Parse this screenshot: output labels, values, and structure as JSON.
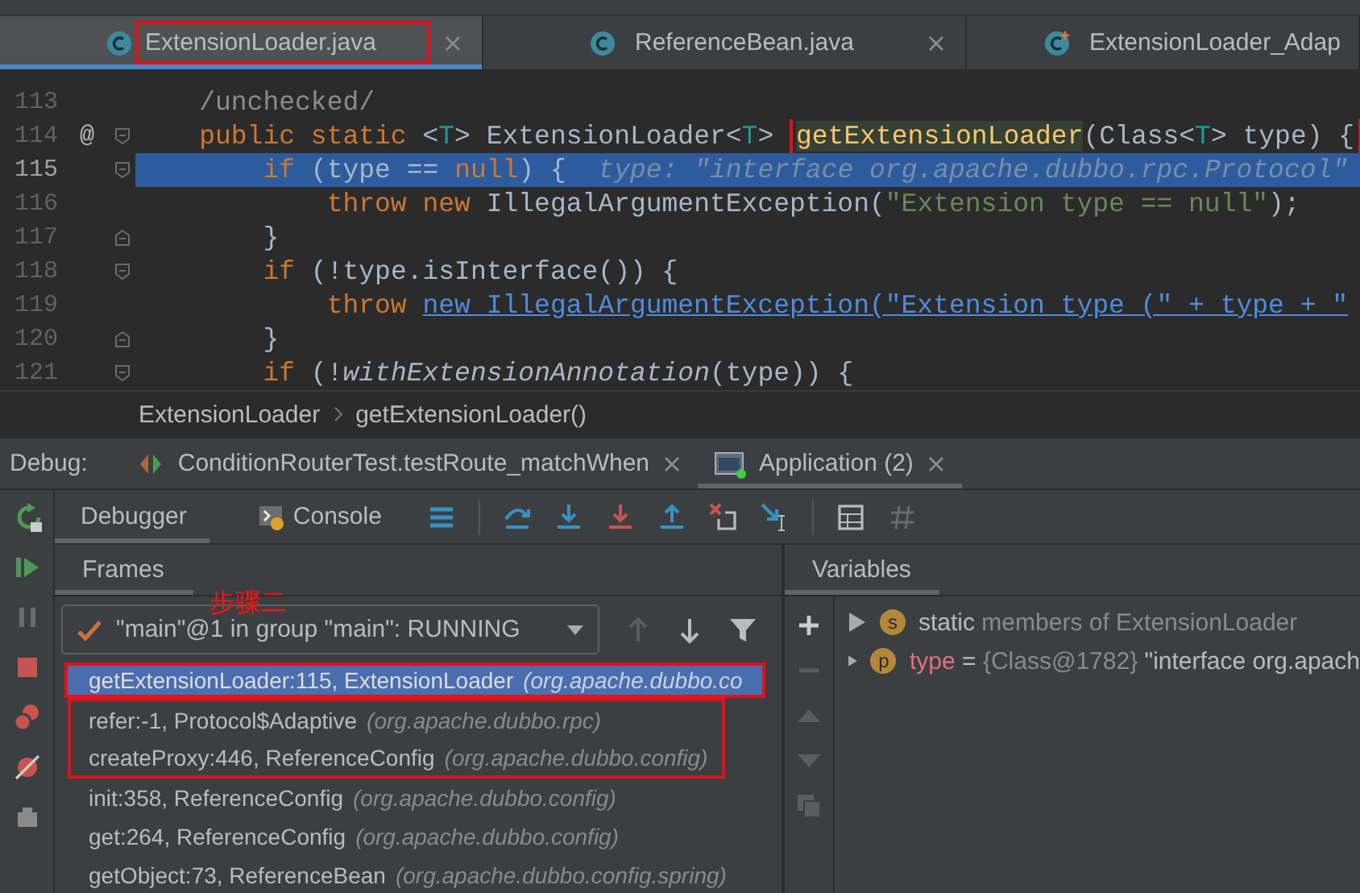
{
  "editor_tabs": [
    {
      "label": "ExtensionLoader.java",
      "selected": true,
      "outlined": true,
      "kind": "class"
    },
    {
      "label": "ReferenceBean.java",
      "selected": false,
      "outlined": false,
      "kind": "class"
    },
    {
      "label": "ExtensionLoader_Adap",
      "selected": false,
      "outlined": false,
      "kind": "generated"
    }
  ],
  "code_lines": [
    {
      "number": "113",
      "current": false,
      "tokens": [
        {
          "kind": "folded",
          "text": "    /unchecked/"
        }
      ]
    },
    {
      "number": "114",
      "current": false,
      "marker": "@",
      "fold_start": true,
      "fold_end": false,
      "tokens": [
        {
          "kind": "keyword",
          "text": "    public static "
        },
        {
          "kind": "plain",
          "text": "<"
        },
        {
          "kind": "typeparam",
          "text": "T"
        },
        {
          "kind": "plain",
          "text": "> ExtensionLoader<"
        },
        {
          "kind": "typeparam",
          "text": "T"
        },
        {
          "kind": "plain",
          "text": "> "
        },
        {
          "kind": "method-decl",
          "text": "getExtensionLoader",
          "outlined": true
        },
        {
          "kind": "plain",
          "text": "(Class<",
          "outlined": true
        },
        {
          "kind": "typeparam",
          "text": "T",
          "outlined": true
        },
        {
          "kind": "plain",
          "text": "> type) {",
          "outlined": true
        }
      ]
    },
    {
      "number": "115",
      "current": true,
      "fold_start": true,
      "fold_end": false,
      "tokens": [
        {
          "kind": "keyword",
          "text": "        if"
        },
        {
          "kind": "plain",
          "text": " (type == "
        },
        {
          "kind": "keyword",
          "text": "null"
        },
        {
          "kind": "plain",
          "text": ") {  "
        },
        {
          "kind": "inline-value",
          "text": "type: \"interface org.apache.dubbo.rpc.Protocol\""
        }
      ]
    },
    {
      "number": "116",
      "current": false,
      "tokens": [
        {
          "kind": "keyword",
          "text": "            throw new "
        },
        {
          "kind": "plain",
          "text": "IllegalArgumentException("
        },
        {
          "kind": "string",
          "text": "\"Extension type == null\""
        },
        {
          "kind": "plain",
          "text": ");"
        }
      ]
    },
    {
      "number": "117",
      "current": false,
      "fold_start": false,
      "fold_end": true,
      "tokens": [
        {
          "kind": "plain",
          "text": "        }"
        }
      ]
    },
    {
      "number": "118",
      "current": false,
      "fold_start": true,
      "fold_end": false,
      "tokens": [
        {
          "kind": "keyword",
          "text": "        if"
        },
        {
          "kind": "plain",
          "text": " (!type.isInterface()) {"
        }
      ]
    },
    {
      "number": "119",
      "current": false,
      "tokens": [
        {
          "kind": "keyword",
          "text": "            throw "
        },
        {
          "kind": "link",
          "text": "new IllegalArgumentException(\"Extension type (\" + type + \""
        }
      ]
    },
    {
      "number": "120",
      "current": false,
      "fold_start": false,
      "fold_end": true,
      "tokens": [
        {
          "kind": "plain",
          "text": "        }"
        }
      ]
    },
    {
      "number": "121",
      "current": false,
      "fold_start": true,
      "fold_end": false,
      "tokens": [
        {
          "kind": "keyword",
          "text": "        if"
        },
        {
          "kind": "plain",
          "text": " (!"
        },
        {
          "kind": "italic",
          "text": "withExtensionAnnotation"
        },
        {
          "kind": "plain",
          "text": "(type)) {"
        }
      ]
    }
  ],
  "breadcrumb": [
    "ExtensionLoader",
    "getExtensionLoader()"
  ],
  "debug_bar": {
    "label": "Debug:",
    "tabs": [
      {
        "label": "ConditionRouterTest.testRoute_matchWhen",
        "selected": false,
        "kind": "test"
      },
      {
        "label": "Application (2)",
        "selected": true,
        "kind": "app"
      }
    ]
  },
  "debug_tabs": [
    {
      "label": "Debugger",
      "selected": true
    },
    {
      "label": "Console",
      "selected": false
    }
  ],
  "frames_panel": {
    "title": "Frames",
    "annotation": "步骤二",
    "thread": "\"main\"@1 in group \"main\": RUNNING",
    "frames": [
      {
        "name": "getExtensionLoader:115, ExtensionLoader",
        "package": "(org.apache.dubbo.co",
        "selected": true,
        "outlined": true,
        "joins_previous_outline": false
      },
      {
        "name": "refer:-1, Protocol$Adaptive",
        "package": "(org.apache.dubbo.rpc)",
        "selected": false,
        "outlined": true,
        "joins_previous_outline": false
      },
      {
        "name": "createProxy:446, ReferenceConfig",
        "package": "(org.apache.dubbo.config)",
        "selected": false,
        "outlined": true,
        "joins_previous_outline": true
      },
      {
        "name": "init:358, ReferenceConfig",
        "package": "(org.apache.dubbo.config)",
        "selected": false,
        "outlined": false,
        "joins_previous_outline": false
      },
      {
        "name": "get:264, ReferenceConfig",
        "package": "(org.apache.dubbo.config)",
        "selected": false,
        "outlined": false,
        "joins_previous_outline": false
      },
      {
        "name": "getObject:73, ReferenceBean",
        "package": "(org.apache.dubbo.config.spring)",
        "selected": false,
        "outlined": false,
        "joins_previous_outline": false
      }
    ]
  },
  "variables_panel": {
    "title": "Variables",
    "items": [
      {
        "badge": "s",
        "parts": [
          {
            "kind": "name",
            "text": "static"
          },
          {
            "kind": "dim",
            "text": " members of ExtensionLoader"
          }
        ]
      },
      {
        "badge": "p",
        "parts": [
          {
            "kind": "var",
            "text": "type"
          },
          {
            "kind": "name",
            "text": " = "
          },
          {
            "kind": "dim",
            "text": "{Class@1782}"
          },
          {
            "kind": "name",
            "text": " \"interface org.apach"
          }
        ]
      }
    ]
  }
}
